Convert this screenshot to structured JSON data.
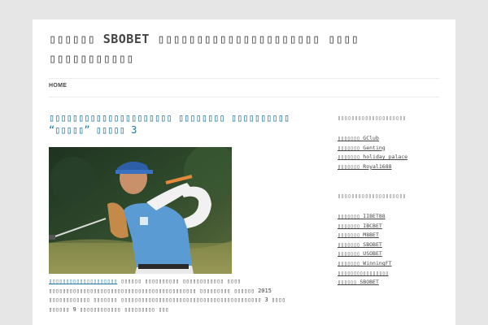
{
  "site": {
    "title": "▯▯▯▯▯▯ SBOBET ▯▯▯▯▯▯▯▯▯▯▯▯▯▯▯▯▯▯▯▯▯ ▯▯▯▯ ▯▯▯▯▯▯▯▯▯▯▯"
  },
  "nav": {
    "home_label": "HOME"
  },
  "post": {
    "title": "▯▯▯▯▯▯▯▯▯▯▯▯▯▯▯▯▯▯▯▯▯ ▯▯▯▯▯▯▯▯ ▯▯▯▯▯▯▯▯▯▯ “▯▯▯▯▯” ▯▯▯▯▯ 3",
    "excerpt_lead": "▯▯▯▯▯▯▯▯▯▯▯▯▯▯▯▯▯▯▯▯",
    "excerpt_body": " ▯▯▯▯▯▯ ▯▯▯▯▯▯▯▯▯▯ ▯▯▯▯▯▯▯▯▯▯▯▯ ▯▯▯▯ ▯▯▯▯▯▯▯▯▯▯▯▯▯▯▯▯▯▯▯▯▯▯▯▯▯▯▯▯▯▯▯▯▯▯▯▯▯▯▯▯▯▯▯ ▯▯▯▯▯▯▯▯▯ ▯▯▯▯▯▯ 2015 ▯▯▯▯▯▯▯▯▯▯▯▯ ▯▯▯▯▯▯▯ ▯▯▯▯▯▯▯▯▯▯▯▯▯▯▯▯▯▯▯▯▯▯▯▯▯▯▯▯▯▯▯▯▯▯▯▯▯▯▯▯▯ 3 ▯▯▯▯ ▯▯▯▯▯▯ 9 ▯▯▯▯▯▯▯▯▯▯▯▯ ▯▯▯▯▯▯▯▯▯ ▯▯▯"
  },
  "sidebar": {
    "widget1": {
      "title": "▯▯▯▯▯▯▯▯▯▯▯▯▯▯▯▯▯▯▯▯",
      "items": [
        "▯▯▯▯▯▯▯ GClub",
        "▯▯▯▯▯▯▯ Genting",
        "▯▯▯▯▯▯▯ holiday palace",
        "▯▯▯▯▯▯▯ Royal1688"
      ]
    },
    "widget2": {
      "title": "▯▯▯▯▯▯▯▯▯▯▯▯▯▯▯▯▯▯▯▯",
      "items": [
        "▯▯▯▯▯▯▯ IIBET88",
        "▯▯▯▯▯▯▯ IBCBET",
        "▯▯▯▯▯▯▯ M8BET",
        "▯▯▯▯▯▯▯ SBOBET",
        "▯▯▯▯▯▯▯ USOBET",
        "▯▯▯▯▯▯▯ WinningFT",
        "▯▯▯▯▯▯▯▯▯▯▯▯▯▯▯▯",
        "▯▯▯▯▯▯ SBOBET"
      ]
    }
  },
  "colors": {
    "link": "#21759b",
    "text": "#444444",
    "background": "#e6e6e6"
  }
}
